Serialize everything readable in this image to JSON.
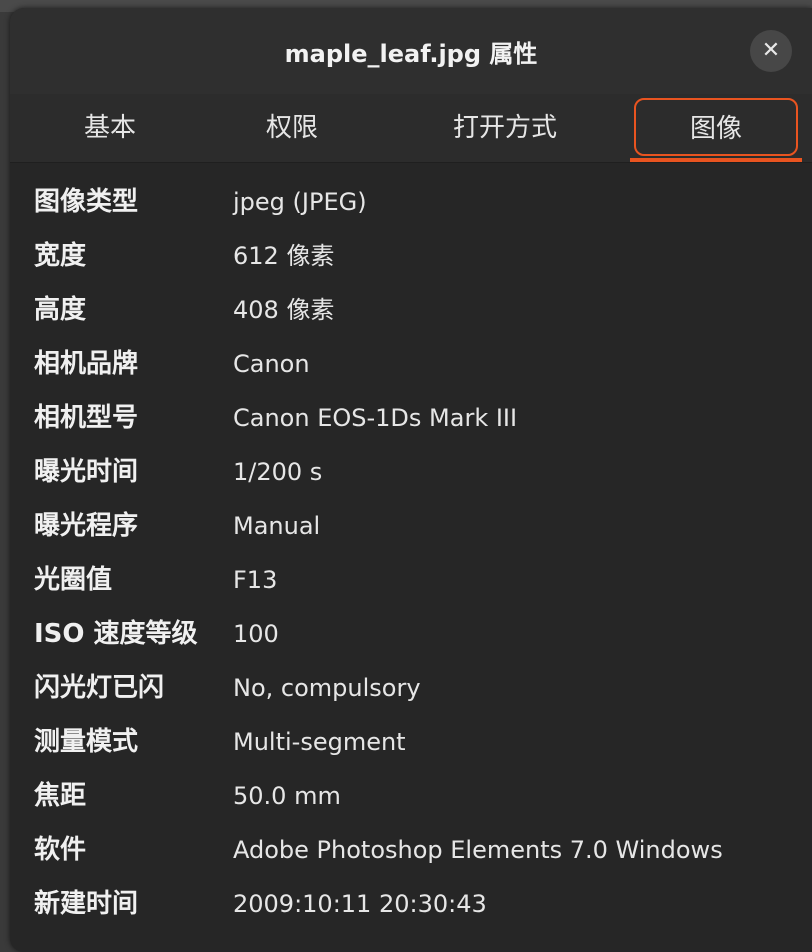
{
  "window": {
    "title": "maple_leaf.jpg 属性",
    "close_glyph": "✕"
  },
  "tabs": [
    {
      "label": "基本"
    },
    {
      "label": "权限"
    },
    {
      "label": "打开方式"
    },
    {
      "label": "图像",
      "selected": true
    }
  ],
  "colors": {
    "accent": "#e95420"
  },
  "properties": [
    {
      "label": "图像类型",
      "value": "jpeg (JPEG)"
    },
    {
      "label": "宽度",
      "value": "612 像素"
    },
    {
      "label": "高度",
      "value": "408 像素"
    },
    {
      "label": "相机品牌",
      "value": "Canon"
    },
    {
      "label": "相机型号",
      "value": "Canon EOS-1Ds Mark III"
    },
    {
      "label": "曝光时间",
      "value": "1/200 s"
    },
    {
      "label": "曝光程序",
      "value": "Manual"
    },
    {
      "label": "光圈值",
      "value": "F13"
    },
    {
      "label": "ISO 速度等级",
      "value": "100"
    },
    {
      "label": "闪光灯已闪",
      "value": "No, compulsory"
    },
    {
      "label": "测量模式",
      "value": "Multi-segment"
    },
    {
      "label": "焦距",
      "value": "50.0 mm"
    },
    {
      "label": "软件",
      "value": "Adobe Photoshop Elements 7.0 Windows"
    },
    {
      "label": "新建时间",
      "value": "2009:10:11 20:30:43"
    }
  ]
}
